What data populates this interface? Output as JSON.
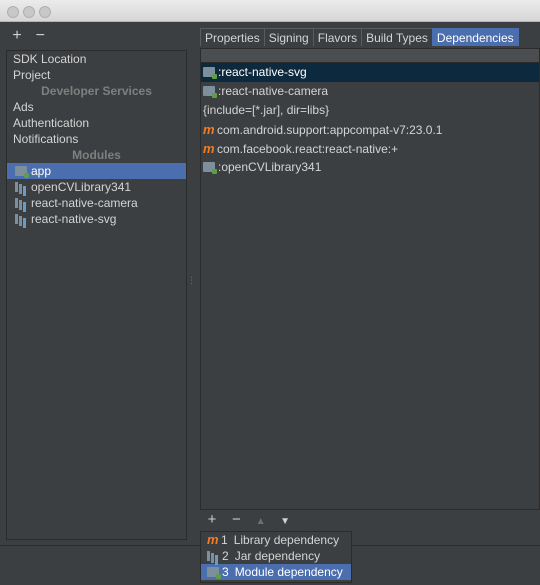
{
  "left": {
    "toolbar": {
      "add": "+",
      "remove": "−"
    },
    "items": [
      {
        "label": "SDK Location"
      },
      {
        "label": "Project"
      }
    ],
    "developer_services_header": "Developer Services",
    "services": [
      {
        "label": "Ads"
      },
      {
        "label": "Authentication"
      },
      {
        "label": "Notifications"
      }
    ],
    "modules_header": "Modules",
    "modules": [
      {
        "label": "app",
        "selected": true,
        "icon": "module-folder-icon"
      },
      {
        "label": "openCVLibrary341",
        "icon": "library-module-icon"
      },
      {
        "label": "react-native-camera",
        "icon": "library-module-icon"
      },
      {
        "label": "react-native-svg",
        "icon": "library-module-icon"
      }
    ]
  },
  "tabs": [
    {
      "label": "Properties"
    },
    {
      "label": "Signing"
    },
    {
      "label": "Flavors"
    },
    {
      "label": "Build Types"
    },
    {
      "label": "Dependencies",
      "active": true
    }
  ],
  "dependencies": [
    {
      "label": ":react-native-svg",
      "icon": "module-folder-icon",
      "selected": true
    },
    {
      "label": ":react-native-camera",
      "icon": "module-folder-icon"
    },
    {
      "label": "{include=[*.jar], dir=libs}",
      "icon": "none"
    },
    {
      "label": "com.android.support:appcompat-v7:23.0.1",
      "icon": "maven-icon"
    },
    {
      "label": "com.facebook.react:react-native:+",
      "icon": "maven-icon"
    },
    {
      "label": ":openCVLibrary341",
      "icon": "module-folder-icon"
    }
  ],
  "maven_glyph": "m",
  "bottom_toolbar": {
    "add": "+",
    "remove": "−",
    "up": "▲",
    "down": "▼"
  },
  "popup": [
    {
      "num": "1",
      "label": "Library dependency",
      "icon": "maven-icon"
    },
    {
      "num": "2",
      "label": "Jar dependency",
      "icon": "jar-icon"
    },
    {
      "num": "3",
      "label": "Module dependency",
      "icon": "module-folder-icon",
      "selected": true
    }
  ],
  "colors": {
    "background": "#3c3f41",
    "selection": "#4b6eaf",
    "row_selection": "#0d293e",
    "maven_orange": "#f07c28"
  }
}
